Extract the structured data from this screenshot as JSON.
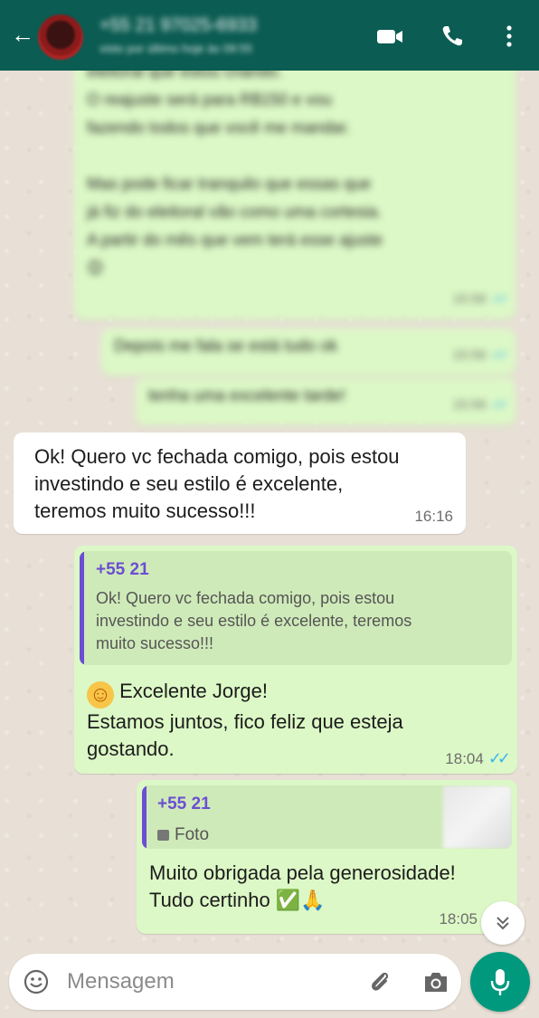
{
  "header": {
    "contact_name": "+55 21 97025-6933",
    "status": "visto por último hoje às 09:55",
    "icons": [
      "back-arrow-icon",
      "avatar",
      "video-call-icon",
      "phone-icon",
      "more-options-icon"
    ]
  },
  "blurred_messages": {
    "msg1_lines": [
      "eleitoral que estou criando.",
      "O reajuste será para R$150 e vou",
      "fazendo todos que você me mandar.",
      "",
      "Mas pode ficar tranquilo que essas que",
      "já fiz do eleitoral vão como uma cortesia.",
      "A partir do mês que vem terá esse ajuste",
      "😊"
    ],
    "msg1_time": "15:56",
    "msg2_text": "Depois me fala se está tudo ok",
    "msg2_time": "15:56",
    "msg3_text": "tenha uma excelente tarde!",
    "msg3_time": "15:56"
  },
  "messages": {
    "incoming": {
      "lines": [
        "Ok! Quero vc fechada comigo, pois estou",
        "investindo e seu estilo é excelente,",
        "teremos muito sucesso!!!"
      ],
      "time": "16:16"
    },
    "reply1": {
      "quoted_name": "+55 21",
      "quoted_lines": [
        "Ok! Quero vc fechada comigo, pois estou",
        "investindo e seu estilo é excelente, teremos",
        "muito sucesso!!!"
      ],
      "line1_emoji": "☺",
      "line1_text": "Excelente Jorge!",
      "lines": [
        "Estamos juntos, fico feliz que esteja",
        "gostando."
      ],
      "time": "18:04",
      "ticks": "✓✓"
    },
    "reply2": {
      "quoted_name": "+55 21",
      "quoted_media_label": "Foto",
      "line1": "Muito obrigada pela generosidade!",
      "line2_text": "Tudo certinho",
      "line2_emojis": "✅🙏",
      "time": "18:05"
    }
  },
  "composer": {
    "placeholder": "Mensagem",
    "icons": [
      "emoji-icon",
      "attach-icon",
      "camera-icon",
      "mic-icon"
    ]
  },
  "colors": {
    "header": "#0b5c52",
    "outgoing_bubble": "#dcf8c6",
    "incoming_bubble": "#ffffff",
    "quote_accent": "#6b4ed1",
    "read_ticks": "#34b7f1",
    "mic_button": "#00997d"
  }
}
